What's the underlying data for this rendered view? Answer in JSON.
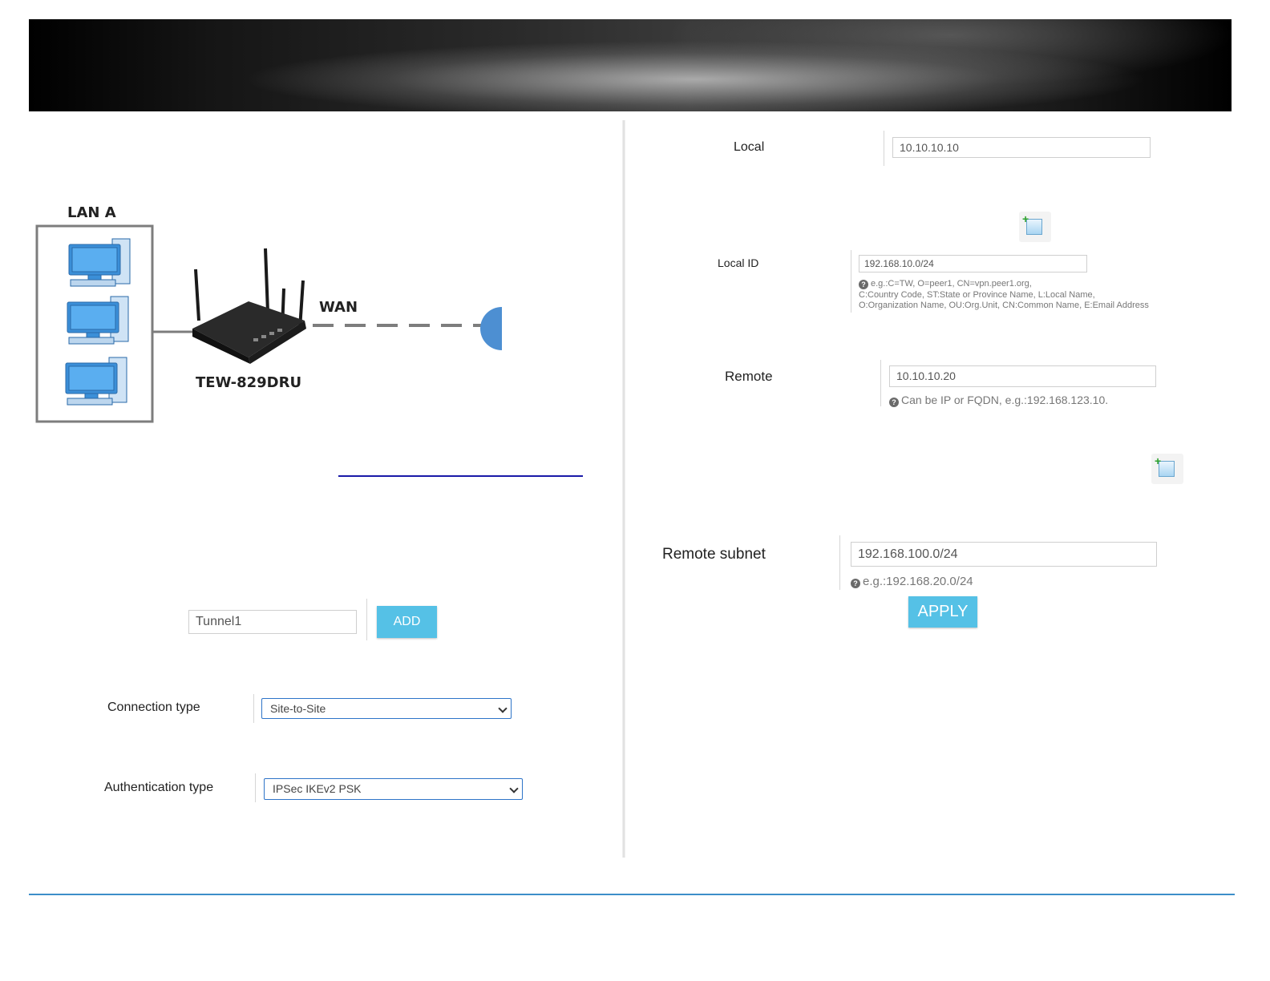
{
  "diagram": {
    "lan_label": "LAN A",
    "wan_label": "WAN",
    "router_label": "TEW-829DRU"
  },
  "tunnel": {
    "name_value": "Tunnel1",
    "add_label": "ADD"
  },
  "connection": {
    "label": "Connection type",
    "value": "Site-to-Site"
  },
  "authentication": {
    "label": "Authentication type",
    "value": "IPSec IKEv2 PSK"
  },
  "local": {
    "label": "Local",
    "value": "10.10.10.10"
  },
  "local_id": {
    "label": "Local ID",
    "value": "192.168.10.0/24",
    "hint_line1": "e.g.:C=TW, O=peer1, CN=vpn.peer1.org,",
    "hint_line2": "C:Country Code, ST:State or Province Name, L:Local Name,",
    "hint_line3": "O:Organization Name, OU:Org.Unit, CN:Common Name, E:Email Address"
  },
  "remote": {
    "label": "Remote",
    "value": "10.10.10.20",
    "hint": "Can be IP or FQDN, e.g.:192.168.123.10."
  },
  "remote_subnet": {
    "label": "Remote subnet",
    "value": "192.168.100.0/24",
    "hint": "e.g.:192.168.20.0/24"
  },
  "apply_label": "APPLY",
  "colors": {
    "accent_button": "#55c1e6",
    "footer_rule": "#3c8ec9",
    "select_border": "#2e74c8"
  },
  "icons": {
    "add_entry": "add-entry-icon",
    "help": "help-icon"
  }
}
